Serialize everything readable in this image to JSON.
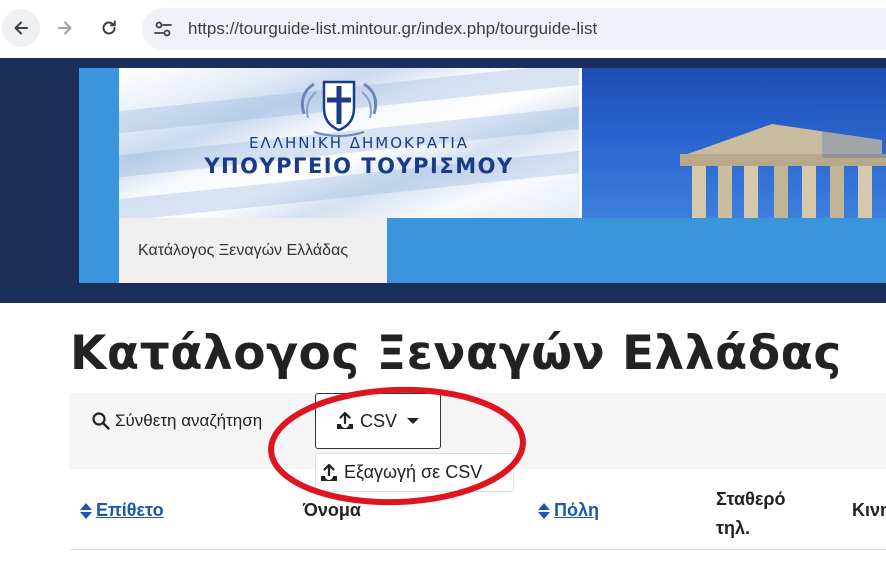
{
  "browser": {
    "url": "https://tourguide-list.mintour.gr/index.php/tourguide-list"
  },
  "header": {
    "republic_text": "ΕΛΛΗΝΙΚΗ ΔΗΜΟΚΡΑΤΙΑ",
    "ministry_text": "ΥΠΟΥΡΓΕΙΟ ΤΟΥΡΙΣΜΟΥ",
    "menu_tab_label": "Κατάλογος Ξεναγών Ελλάδας"
  },
  "main": {
    "page_title": "Κατάλογος Ξεναγών Ελλάδας",
    "toolbar": {
      "advanced_search_label": "Σύνθετη αναζήτηση",
      "csv_button_label": "CSV",
      "dropdown_item_label": "Εξαγωγή σε CSV"
    },
    "table": {
      "columns": [
        {
          "label": "Επίθετο",
          "sortable": true
        },
        {
          "label": "Όνομα",
          "sortable": false
        },
        {
          "label": "Πόλη",
          "sortable": true
        },
        {
          "label": "Σταθερό τηλ.",
          "sortable": false
        },
        {
          "label": "Κινη",
          "sortable": false
        }
      ]
    }
  },
  "colors": {
    "header_navy": "#1c2e5a",
    "menu_blue": "#3b95db",
    "link_blue": "#1a57b5",
    "annotation_red": "#e0141e"
  }
}
